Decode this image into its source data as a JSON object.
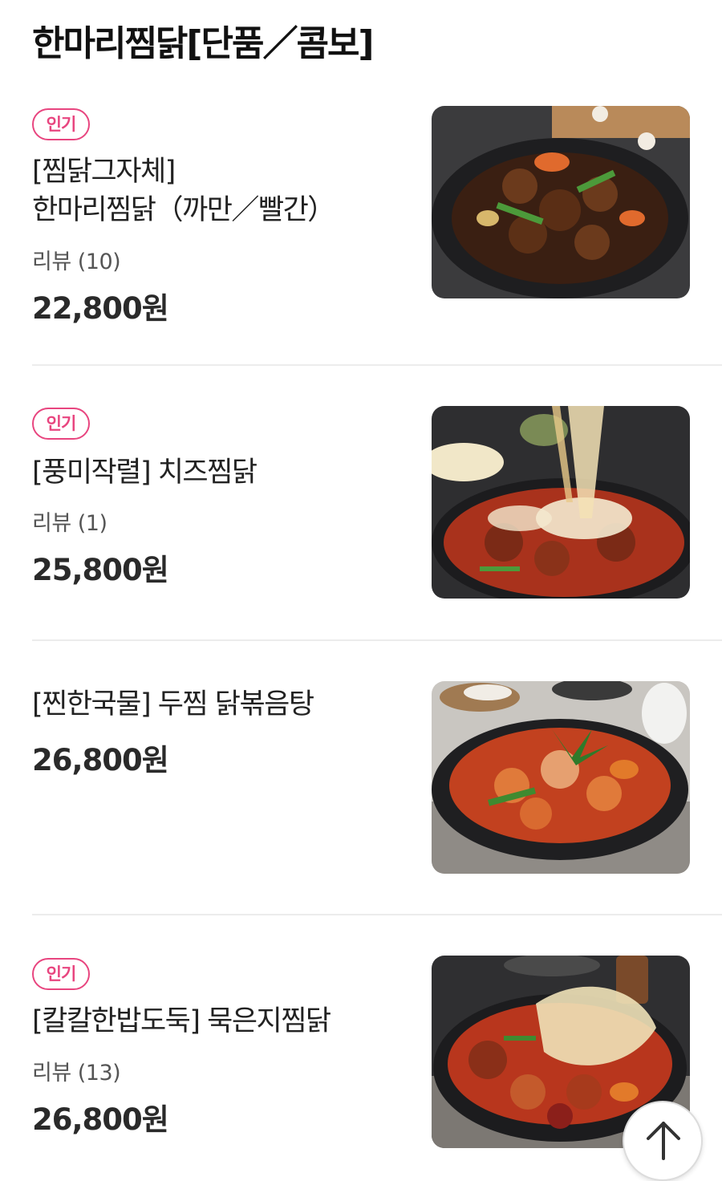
{
  "section": {
    "title": "한마리찜닭[단품／콤보]"
  },
  "items": [
    {
      "badge": "인기",
      "name_line1": "[찜닭그자체]",
      "name_line2": "한마리찜닭（까만／빨간）",
      "review": "리뷰 (10)",
      "price": "22,800원",
      "image_icon": "braised-chicken-dark-sauce-photo"
    },
    {
      "badge": "인기",
      "name_line1": "[풍미작렬] 치즈찜닭",
      "review": "리뷰 (1)",
      "price": "25,800원",
      "image_icon": "cheese-braised-chicken-photo"
    },
    {
      "name_line1": "[찐한국물] 두찜 닭볶음탕",
      "price": "26,800원",
      "image_icon": "spicy-chicken-stew-photo"
    },
    {
      "badge": "인기",
      "name_line1": "[칼칼한밥도둑] 묵은지찜닭",
      "review": "리뷰 (13)",
      "price": "26,800원",
      "image_icon": "kimchi-braised-chicken-photo"
    }
  ],
  "controls": {
    "scroll_top_icon": "arrow-up-icon"
  },
  "colors": {
    "accent": "#e8457f",
    "text": "#222222",
    "divider": "#ececec"
  }
}
